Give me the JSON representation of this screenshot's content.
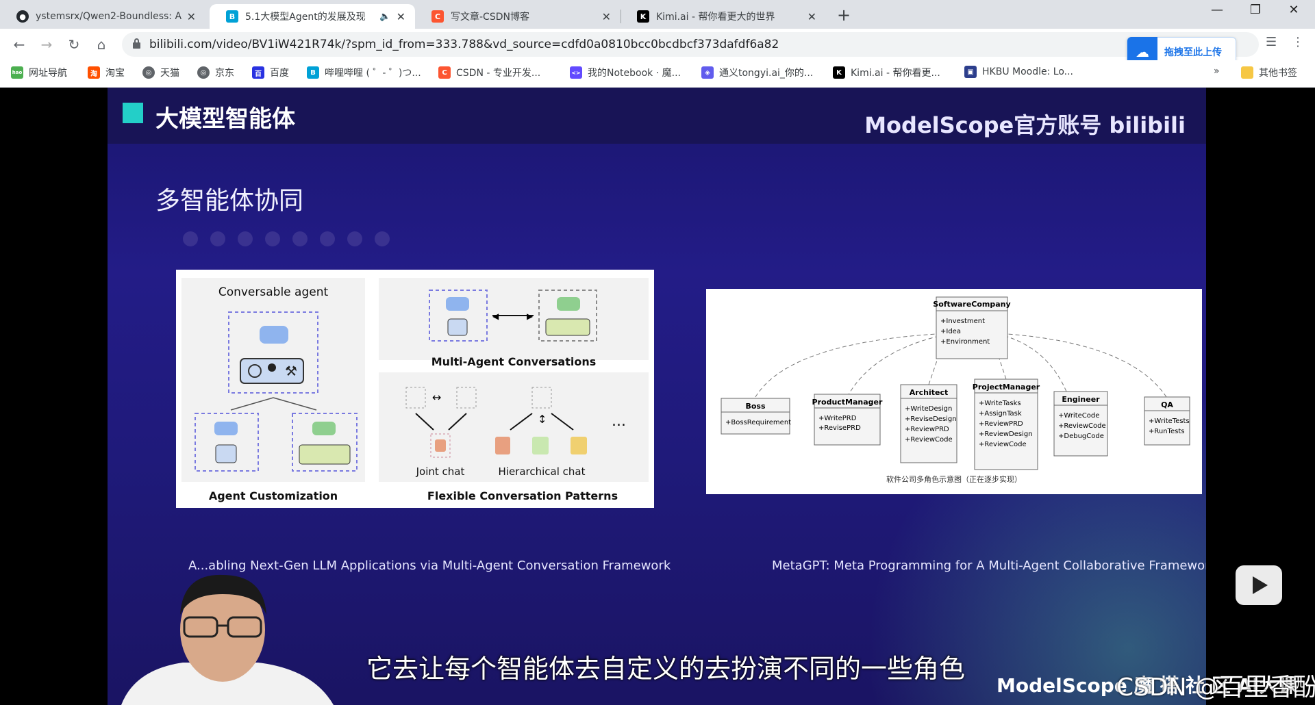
{
  "tabs": [
    {
      "title": "ystemsrx/Qwen2-Boundless: A",
      "active": false
    },
    {
      "title": "5.1大模型Agent的发展及现",
      "active": true
    },
    {
      "title": "写文章-CSDN博客",
      "active": false
    },
    {
      "title": "Kimi.ai - 帮你看更大的世界",
      "active": false
    }
  ],
  "address_bar": {
    "url": "bilibili.com/video/BV1iW421R74k/?spm_id_from=333.788&vd_source=cdfd0a0810bcc0bcdbcf373dafdf6a82"
  },
  "extension": {
    "upload_label": "拖拽至此上传"
  },
  "bookmarks": [
    {
      "label": "网址导航",
      "color": "#4caf50",
      "glyph": "hao"
    },
    {
      "label": "淘宝",
      "color": "#ff5000",
      "glyph": "淘"
    },
    {
      "label": "天猫",
      "color": "#5f6368",
      "glyph": "◎"
    },
    {
      "label": "京东",
      "color": "#5f6368",
      "glyph": "◎"
    },
    {
      "label": "百度",
      "color": "#2932e1",
      "glyph": "百"
    },
    {
      "label": "哔哩哔哩 ( ゜- ゜)つ...",
      "color": "#00a1d6",
      "glyph": "B"
    },
    {
      "label": "CSDN - 专业开发...",
      "color": "#fc5531",
      "glyph": "C"
    },
    {
      "label": "我的Notebook · 魔...",
      "color": "#624aff",
      "glyph": "<>"
    },
    {
      "label": "通义tongyi.ai_你的...",
      "color": "#615ced",
      "glyph": "◈"
    },
    {
      "label": "Kimi.ai - 帮你看更...",
      "color": "#000000",
      "glyph": "K"
    },
    {
      "label": "HKBU Moodle: Lo...",
      "color": "#2c3e8c",
      "glyph": "▣"
    }
  ],
  "other_bookmarks": "其他书签",
  "slide": {
    "title": "大模型智能体",
    "brand": "ModelScope官方账号 bilibili",
    "section": "多智能体协同",
    "autogen": {
      "conversable_agent": "Conversable agent",
      "multi_agent": "Multi-Agent Conversations",
      "joint_chat": "Joint chat",
      "hierarchical_chat": "Hierarchical chat",
      "agent_customization": "Agent Customization",
      "flexible": "Flexible Conversation Patterns",
      "ellipsis": "..."
    },
    "metagpt": {
      "company": "SoftwareCompany",
      "company_attrs": [
        "+Investment",
        "+Idea",
        "+Environment"
      ],
      "roles": [
        {
          "name": "Boss",
          "attrs": [
            "+BossRequirement"
          ]
        },
        {
          "name": "ProductManager",
          "attrs": [
            "+WritePRD",
            "+RevisePRD"
          ]
        },
        {
          "name": "Architect",
          "attrs": [
            "+WriteDesign",
            "+ReviseDesign",
            "+ReviewPRD",
            "+ReviewCode"
          ]
        },
        {
          "name": "ProjectManager",
          "attrs": [
            "+WriteTasks",
            "+AssignTask",
            "+ReviewPRD",
            "+ReviewDesign",
            "+ReviewCode"
          ]
        },
        {
          "name": "Engineer",
          "attrs": [
            "+WriteCode",
            "+ReviewCode",
            "+DebugCode"
          ]
        },
        {
          "name": "QA",
          "attrs": [
            "+WriteTests",
            "+RunTests"
          ]
        }
      ],
      "caption": "软件公司多角色示意图（正在逐步实现）"
    },
    "caption_left": "A...abling Next-Gen LLM Applications via Multi-Agent Conversation Framework",
    "caption_right": "MetaGPT:  Meta Programming for A Multi-Agent Collaborative Framework",
    "footer_logo": "ModelScope 魔 搭 社 区 AI大课"
  },
  "video": {
    "subtitle": "它去让每个智能体去自定义的去扮演不同的一些角色",
    "watermark": "CSDN @百里香酚兰"
  },
  "colors": {
    "accent_square": "#23cfc8",
    "slide_bg": "#1f1a7a",
    "tab_bar": "#dee1e6"
  }
}
